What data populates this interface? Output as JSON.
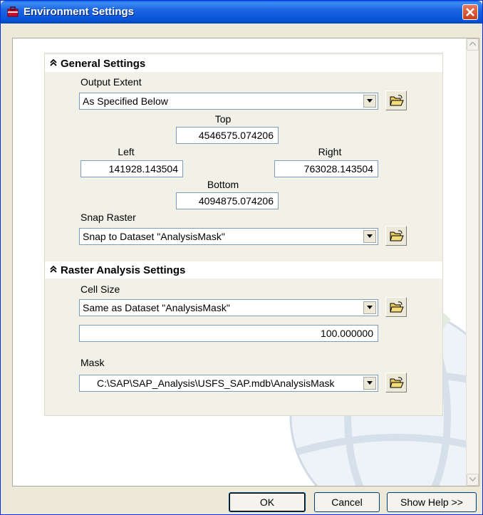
{
  "window": {
    "title": "Environment Settings"
  },
  "general": {
    "header": "General Settings",
    "output_extent": {
      "label": "Output Extent",
      "value": "As Specified Below",
      "top_label": "Top",
      "top_value": "4546575.074206",
      "left_label": "Left",
      "left_value": "141928.143504",
      "right_label": "Right",
      "right_value": "763028.143504",
      "bottom_label": "Bottom",
      "bottom_value": "4094875.074206"
    },
    "snap_raster": {
      "label": "Snap Raster",
      "value": "Snap to Dataset \"AnalysisMask\""
    }
  },
  "raster": {
    "header": "Raster Analysis Settings",
    "cell_size": {
      "label": "Cell Size",
      "value": "Same as Dataset \"AnalysisMask\"",
      "number": "100.000000"
    },
    "mask": {
      "label": "Mask",
      "value": "C:\\SAP\\SAP_Analysis\\USFS_SAP.mdb\\AnalysisMask"
    }
  },
  "buttons": {
    "ok": "OK",
    "cancel": "Cancel",
    "help": "Show Help >>"
  }
}
